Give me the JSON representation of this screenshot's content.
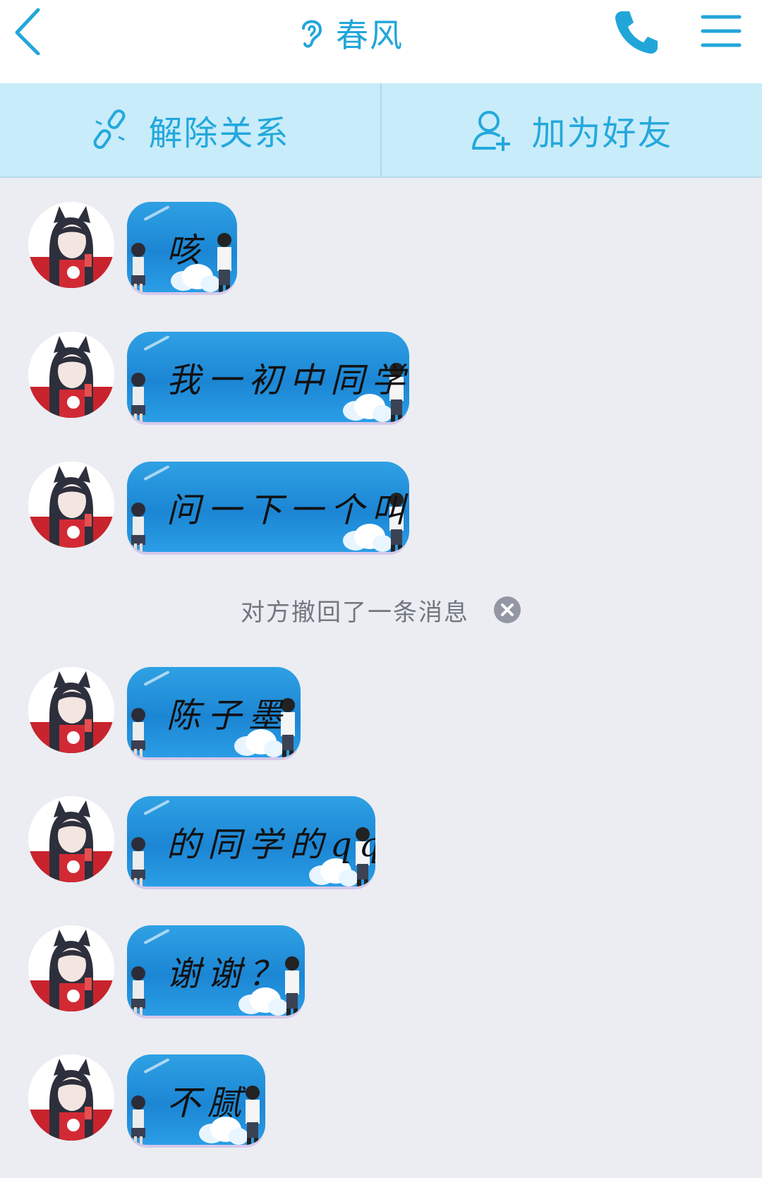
{
  "header": {
    "title": "春风",
    "back_icon": "chevron-left-icon",
    "ear_icon": "ear-icon",
    "phone_icon": "phone-icon",
    "menu_icon": "menu-icon",
    "accent_color": "#22a6da"
  },
  "actions": {
    "unlink_label": "解除关系",
    "add_friend_label": "加为好友"
  },
  "messages": [
    {
      "text": "咳"
    },
    {
      "text": "我一初中同学"
    },
    {
      "text": "问一下一个叫"
    },
    {
      "text": "陈子墨"
    },
    {
      "text": "的同学的qq"
    },
    {
      "text": "谢谢？"
    },
    {
      "text": "不腻"
    }
  ],
  "system": {
    "recall_notice": "对方撤回了一条消息"
  }
}
